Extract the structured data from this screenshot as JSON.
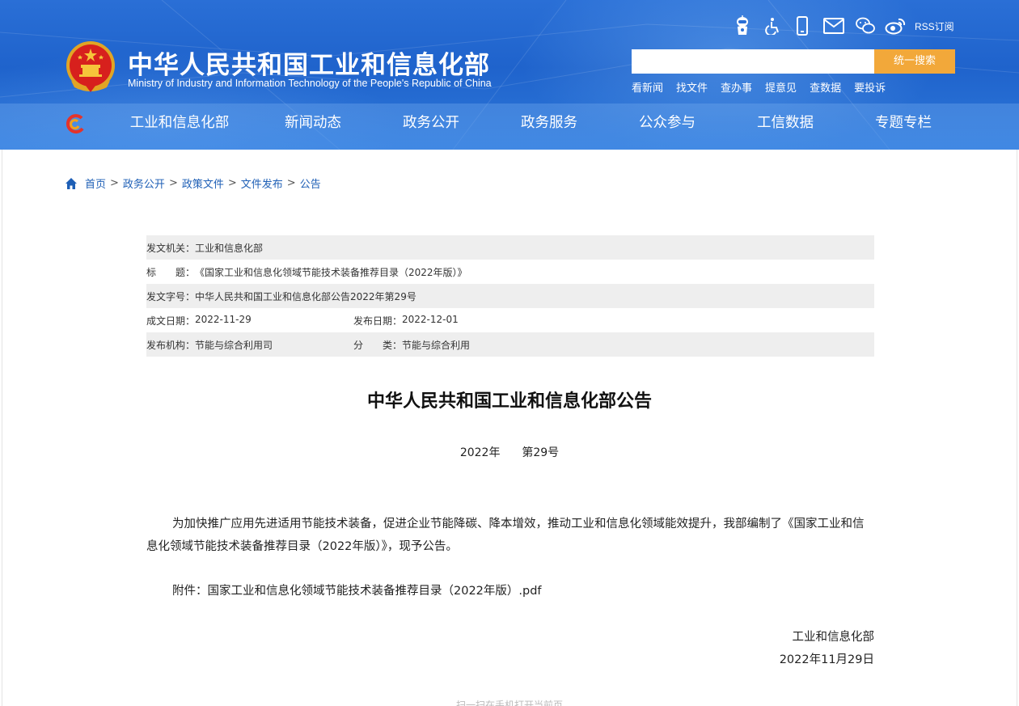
{
  "header": {
    "title": "中华人民共和国工业和信息化部",
    "subtitle": "Ministry of Industry and Information Technology of the People's Republic of China",
    "tools": {
      "icons": [
        "robot-assistant-icon",
        "accessibility-icon",
        "mobile-icon",
        "mail-icon",
        "wechat-icon",
        "weibo-icon"
      ],
      "rss_label": "RSS订阅"
    },
    "search": {
      "placeholder": "",
      "button_label": "统一搜索"
    },
    "quicklinks": [
      "看新闻",
      "找文件",
      "查办事",
      "提意见",
      "查数据",
      "要投诉"
    ],
    "nav": [
      "工业和信息化部",
      "新闻动态",
      "政务公开",
      "政务服务",
      "公众参与",
      "工信数据",
      "专题专栏"
    ],
    "colors": {
      "header_blue": "#2a6fd6",
      "search_button": "#f2a83a",
      "link_blue": "#1e5fb6"
    }
  },
  "breadcrumb": [
    "首页",
    "政务公开",
    "政策文件",
    "文件发布",
    "公告"
  ],
  "meta": {
    "issuer_label": "发文机关：",
    "issuer": "工业和信息化部",
    "title_label": "标　　题：",
    "title": "《国家工业和信息化领域节能技术装备推荐目录（2022年版）》",
    "doc_no_label": "发文字号：",
    "doc_no": "中华人民共和国工业和信息化部公告2022年第29号",
    "written_label": "成文日期：",
    "written": "2022-11-29",
    "published_label": "发布日期：",
    "published": "2022-12-01",
    "agency_label": "发布机构：",
    "agency": "节能与综合利用司",
    "category_label": "分　　类：",
    "category": "节能与综合利用"
  },
  "document": {
    "title": "中华人民共和国工业和信息化部公告",
    "year": "2022年",
    "number": "第29号",
    "paragraph1": "为加快推广应用先进适用节能技术装备，促进企业节能降碳、降本增效，推动工业和信息化领域能效提升，我部编制了《国家工业和信息化领域节能技术装备推荐目录（2022年版）》，现予公告。",
    "attachment_label": "附件：",
    "attachment": "国家工业和信息化领域节能技术装备推荐目录（2022年版）.pdf",
    "signer": "工业和信息化部",
    "date": "2022年11月29日"
  },
  "footer_hint": "扫一扫在手机打开当前页"
}
